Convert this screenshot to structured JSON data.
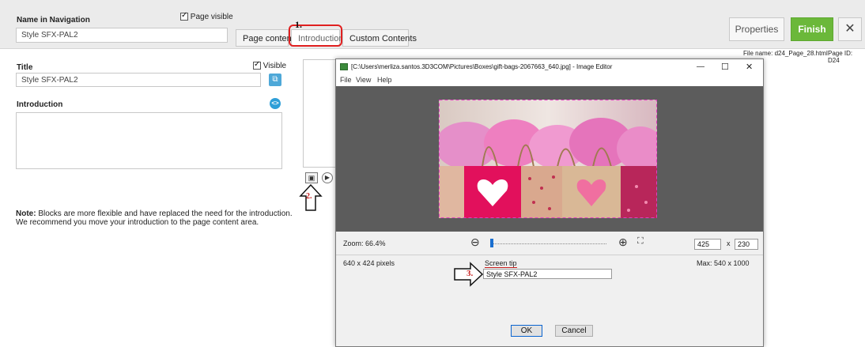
{
  "topbar": {
    "nav_name_label": "Name in Navigation",
    "nav_name_value": "Style SFX-PAL2",
    "page_visible_label": "Page visible",
    "tabs": [
      "Page content",
      "Introduction",
      "Custom Contents"
    ],
    "properties_label": "Properties",
    "finish_label": "Finish",
    "close_glyph": "✕"
  },
  "file_info": {
    "file_name": "File name: d24_Page_28.html",
    "page_id": "Page ID: D24"
  },
  "left": {
    "title_label": "Title",
    "visible_label": "Visible",
    "title_value": "Style SFX-PAL2",
    "intro_label": "Introduction",
    "note_bold": "Note:",
    "note_line1": " Blocks are more flexible and have replaced the need for the introduction.",
    "note_line2": "We recommend you move your introduction to the page content area."
  },
  "callouts": {
    "one": "1.",
    "two": "2.",
    "three": "3."
  },
  "dialog": {
    "title": "[C:\\Users\\merliza.santos.3D3COM\\Pictures\\Boxes\\gift-bags-2067663_640.jpg] - Image Editor",
    "min_glyph": "—",
    "max_glyph": "☐",
    "close_glyph": "✕",
    "menu": [
      "File",
      "View",
      "Help"
    ],
    "zoom_label": "Zoom:  66.4%",
    "width_value": "425",
    "times": "x",
    "height_value": "230",
    "pixels": "640 x 424 pixels",
    "screen_tip_label": "Screen tip",
    "screen_tip_value": "Style SFX-PAL2",
    "max_label": "Max:  540 x 1000",
    "ok_label": "OK",
    "cancel_label": "Cancel"
  },
  "colors": {
    "accent_green": "#6bb83a",
    "callout_red": "#e02020",
    "info_blue": "#2f9fd8"
  }
}
